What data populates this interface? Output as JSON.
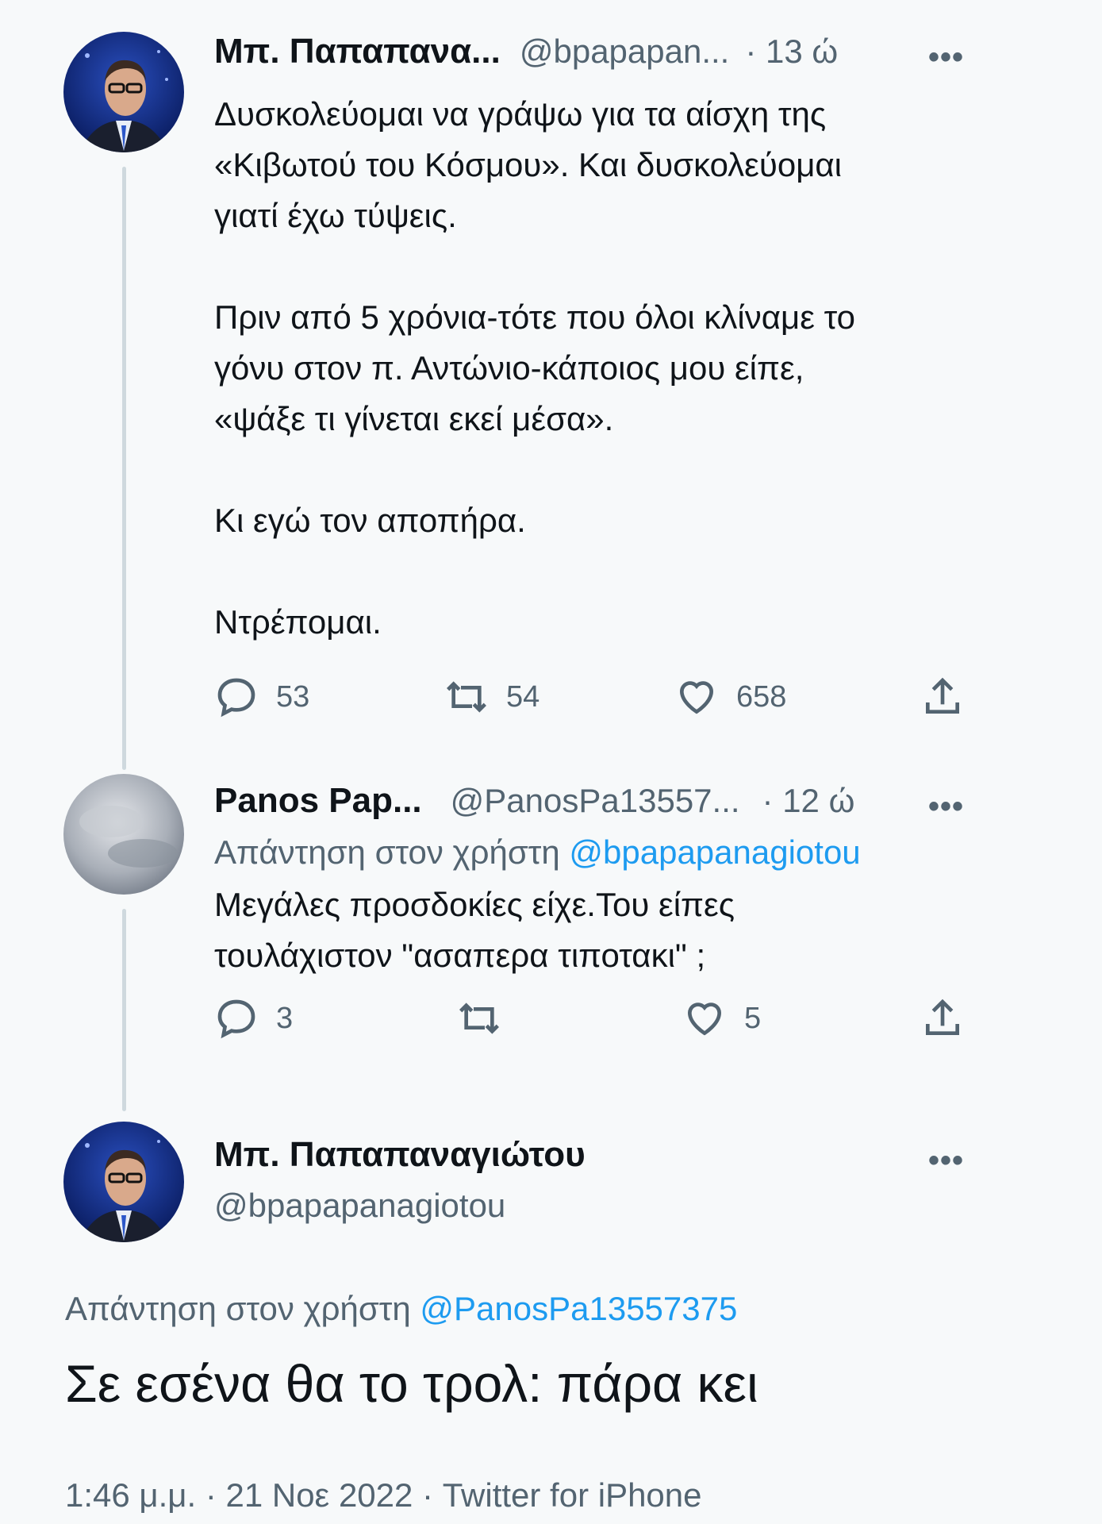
{
  "tweet1": {
    "name": "Μπ. Παπαπανα...",
    "handle": "@bpapapan...",
    "time": "· 13 ώ",
    "more": "•••",
    "text": "Δυσκολεύομαι να γράψω για τα αίσχη της\n«Κιβωτού του Κόσμου». Και δυσκολεύομαι\nγιατί έχω τύψεις.\n\nΠριν από 5 χρόνια-τότε που όλοι κλίναμε το\nγόνυ στον π. Αντώνιο-κάποιος μου είπε,\n«ψάξε τι γίνεται εκεί μέσα».\n\nΚι εγώ τον αποπήρα.\n\nΝτρέπομαι.",
    "replies": "53",
    "retweets": "54",
    "likes": "658"
  },
  "tweet2": {
    "name": "Panos Pap...",
    "handle": "@PanosPa13557...",
    "time": "· 12 ώ",
    "more": "•••",
    "reply_prefix": "Απάντηση στον χρήστη",
    "reply_to": "@bpapapanagiotou",
    "text": "Μεγάλες προσδοκίες είχε.Του είπες\nτουλάχιστον \"ασαπερα τιποτακι\" ;",
    "replies": "3",
    "retweets": "",
    "likes": "5"
  },
  "tweet3": {
    "name": "Μπ. Παπαπαναγιώτου",
    "handle": "@bpapapanagiotou",
    "more": "•••",
    "reply_prefix": "Απάντηση στον χρήστη",
    "reply_to": "@PanosPa13557375",
    "text": "Σε εσένα θα το τρολ: πάρα κει",
    "meta": "1:46 μ.μ. · 21 Νοε 2022 · Twitter for iPhone"
  },
  "colors": {
    "accent": "#1d9bf0",
    "muted": "#536471",
    "line": "#cfd9de"
  },
  "icons": [
    "reply-icon",
    "retweet-icon",
    "like-icon",
    "share-icon",
    "more-icon"
  ]
}
